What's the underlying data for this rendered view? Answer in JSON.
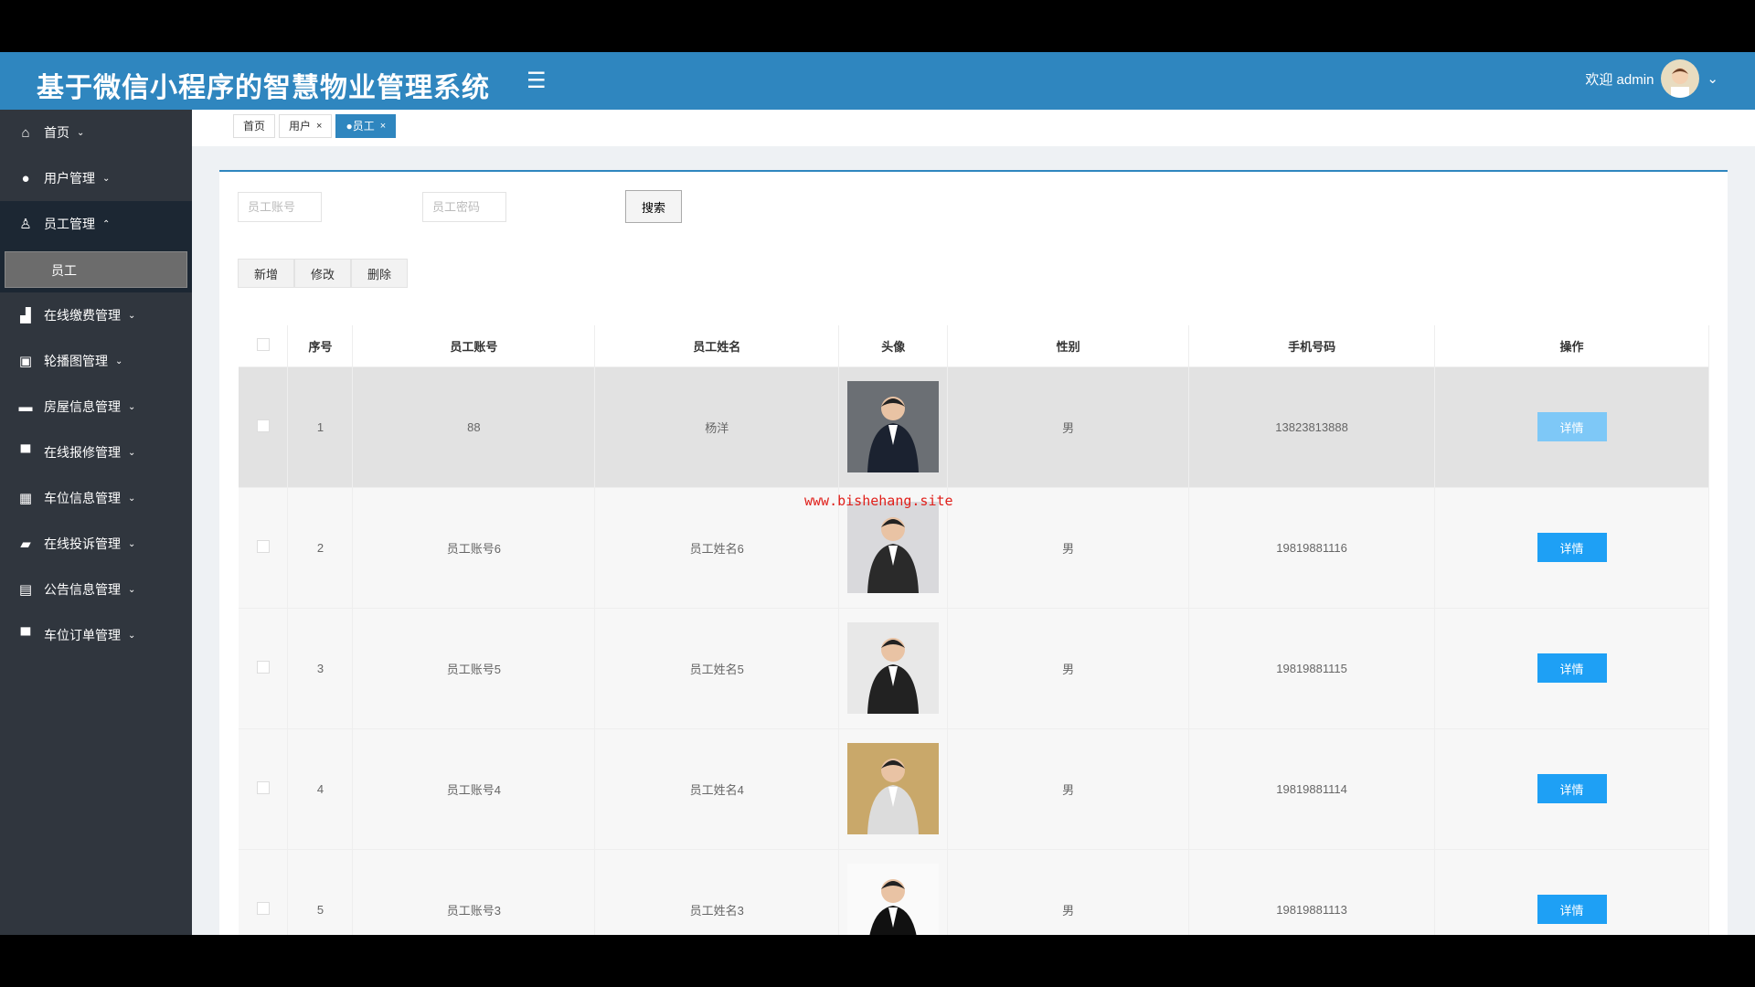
{
  "header": {
    "title": "基于微信小程序的智慧物业管理系统",
    "welcome": "欢迎 admin"
  },
  "sidebar": {
    "items": [
      {
        "label": "首页",
        "icon": "home-icon",
        "chevron": "⌄"
      },
      {
        "label": "用户管理",
        "icon": "user-icon",
        "chevron": "⌄"
      },
      {
        "label": "员工管理",
        "icon": "staff-icon",
        "chevron": "⌃"
      },
      {
        "label": "在线缴费管理",
        "icon": "payment-icon",
        "chevron": "⌄"
      },
      {
        "label": "轮播图管理",
        "icon": "carousel-icon",
        "chevron": "⌄"
      },
      {
        "label": "房屋信息管理",
        "icon": "house-icon",
        "chevron": "⌄"
      },
      {
        "label": "在线报修管理",
        "icon": "repair-icon",
        "chevron": "⌄"
      },
      {
        "label": "车位信息管理",
        "icon": "parking-icon",
        "chevron": "⌄"
      },
      {
        "label": "在线投诉管理",
        "icon": "complaint-icon",
        "chevron": "⌄"
      },
      {
        "label": "公告信息管理",
        "icon": "notice-icon",
        "chevron": "⌄"
      },
      {
        "label": "车位订单管理",
        "icon": "order-icon",
        "chevron": "⌄"
      }
    ],
    "sub_item": "员工"
  },
  "tabs": [
    {
      "label": "首页"
    },
    {
      "label": "用户",
      "close": "×"
    },
    {
      "label": "●员工",
      "close": "×"
    }
  ],
  "search": {
    "account_placeholder": "员工账号",
    "password_placeholder": "员工密码",
    "button": "搜索"
  },
  "actions": {
    "add": "新增",
    "edit": "修改",
    "delete": "删除"
  },
  "table": {
    "headers": [
      "序号",
      "员工账号",
      "员工姓名",
      "头像",
      "性别",
      "手机号码",
      "操作"
    ],
    "rows": [
      {
        "no": "1",
        "account": "88",
        "name": "杨洋",
        "gender": "男",
        "phone": "13823813888",
        "action": "详情"
      },
      {
        "no": "2",
        "account": "员工账号6",
        "name": "员工姓名6",
        "gender": "男",
        "phone": "19819881116",
        "action": "详情"
      },
      {
        "no": "3",
        "account": "员工账号5",
        "name": "员工姓名5",
        "gender": "男",
        "phone": "19819881115",
        "action": "详情"
      },
      {
        "no": "4",
        "account": "员工账号4",
        "name": "员工姓名4",
        "gender": "男",
        "phone": "19819881114",
        "action": "详情"
      },
      {
        "no": "5",
        "account": "员工账号3",
        "name": "员工姓名3",
        "gender": "男",
        "phone": "19819881113",
        "action": "详情"
      }
    ]
  },
  "watermark": "www.bishehang.site",
  "colors": {
    "header": "#2f86bf",
    "sidebar": "#30363e",
    "detail_button": "#1ea0f5"
  }
}
